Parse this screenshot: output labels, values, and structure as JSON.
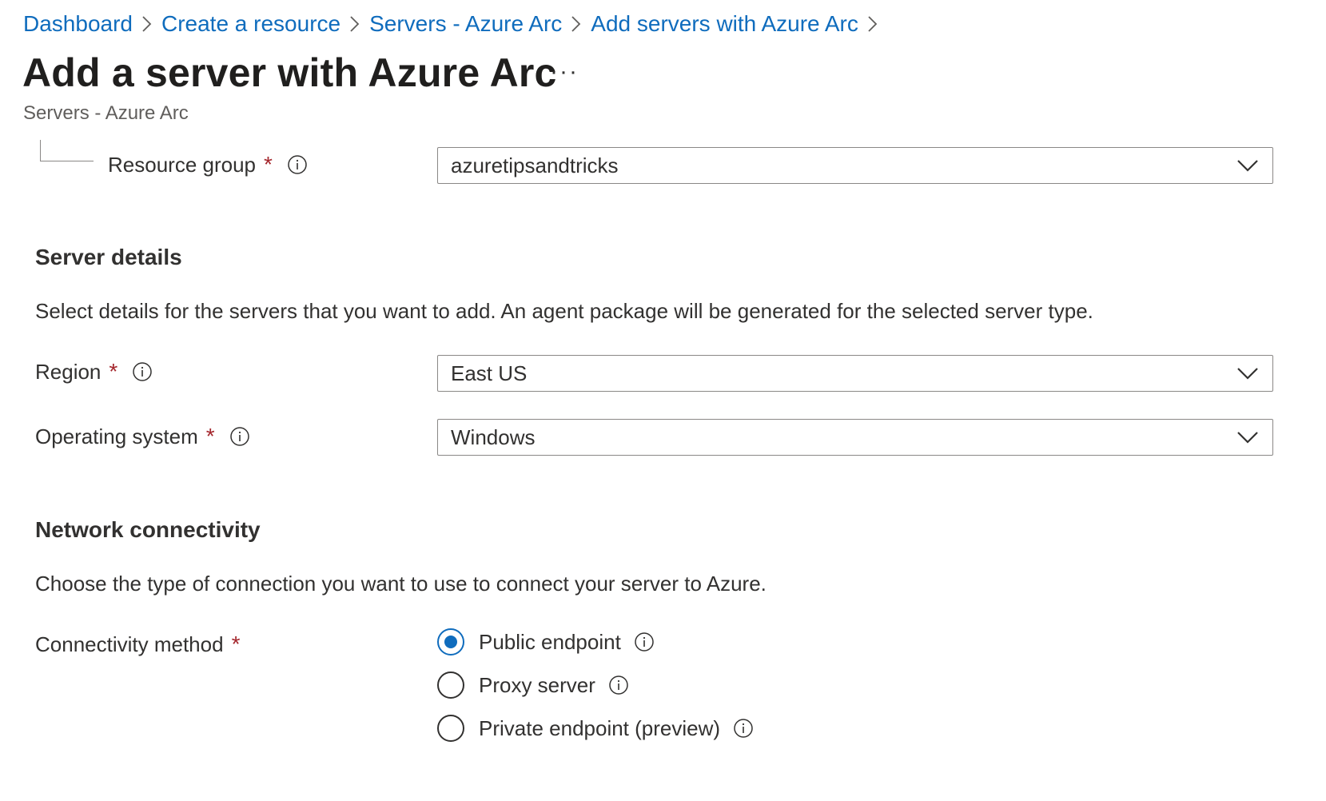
{
  "breadcrumb": [
    "Dashboard",
    "Create a resource",
    "Servers - Azure Arc",
    "Add servers with Azure Arc"
  ],
  "page": {
    "title": "Add a server with Azure Arc",
    "more": "···",
    "subtitle": "Servers - Azure Arc"
  },
  "resource_group": {
    "label": "Resource group",
    "required": "*",
    "value": "azuretipsandtricks"
  },
  "server_details": {
    "title": "Server details",
    "description": "Select details for the servers that you want to add. An agent package will be generated for the selected server type.",
    "region": {
      "label": "Region",
      "required": "*",
      "value": "East US"
    },
    "os": {
      "label": "Operating system",
      "required": "*",
      "value": "Windows"
    }
  },
  "network": {
    "title": "Network connectivity",
    "description": "Choose the type of connection you want to use to connect your server to Azure.",
    "method_label": "Connectivity method",
    "required": "*",
    "options": [
      {
        "label": "Public endpoint",
        "selected": true
      },
      {
        "label": "Proxy server",
        "selected": false
      },
      {
        "label": "Private endpoint (preview)",
        "selected": false
      }
    ]
  },
  "colors": {
    "link": "#0f6cbd",
    "required": "#a4262c",
    "border": "#8a8886",
    "text": "#323130"
  },
  "icons": [
    "chevron-right-icon",
    "info-icon",
    "chevron-down-icon",
    "more-icon"
  ]
}
